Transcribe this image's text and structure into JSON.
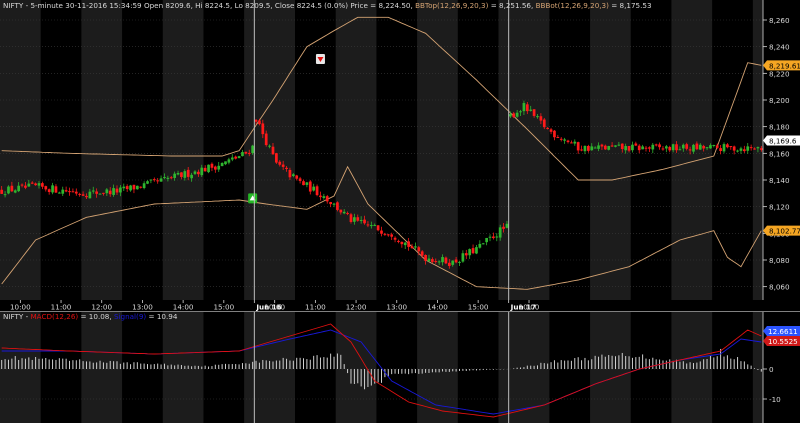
{
  "colors": {
    "background": "#000000",
    "band": "#1c1c1c",
    "grid": "#3a3a3a",
    "text": "#d8d8d8",
    "bullish": "#2fb52f",
    "bearish": "#ff1a1a",
    "bollinger": "#d4a373",
    "macd": "#e01010",
    "signal": "#1818d8",
    "histogram": "#d0d0d0",
    "bbtop_badge": "#f5a623",
    "price_badge": "#ffffff",
    "macd_badge": "#2b54ff",
    "signal_badge": "#d01818"
  },
  "chart_data": [
    {
      "type": "candlestick",
      "header": {
        "symbol": "NIFTY",
        "interval": "5-minute",
        "datetime": "30-11-2016 15:34:59",
        "open": "Open 8209.6,",
        "hi": "Hi 8224.5,",
        "lo": "Lo 8209.5,",
        "close": "Close 8224.5 (0.0%)",
        "price": "Price = 8,224.50,",
        "bbtop_label": "BBTop(12,26,9,20,3)",
        "bbtop_value": "= 8,251.56,",
        "bbbot_label": "BBBot(12,26,9,20,3)",
        "bbbot_value": "= 8,175.53"
      },
      "ylim": [
        8050,
        8275
      ],
      "yticks": [
        8060,
        8080,
        8100,
        8120,
        8140,
        8160,
        8180,
        8200,
        8220,
        8240,
        8260
      ],
      "ytick_labels": [
        "8,060",
        "8,080",
        "8,100",
        "8,120",
        "8,140",
        "8,160",
        "8,180",
        "8,200",
        "8,220",
        "8,240",
        "8,260"
      ],
      "xtick_labels": [
        "10:00",
        "11:00",
        "12:00",
        "13:00",
        "14:00",
        "15:00",
        "Jun 16",
        "10:00",
        "11:00",
        "12:00",
        "13:00",
        "14:00",
        "15:00",
        "Jun 17",
        "10:00"
      ],
      "n_bars": 225,
      "session_breaks_at_bar": [
        75,
        150
      ],
      "sessions": [
        {
          "start": 8132,
          "points": [
            [
              0,
              8132
            ],
            [
              10,
              8135
            ],
            [
              25,
              8130
            ],
            [
              35,
              8132
            ],
            [
              45,
              8138
            ],
            [
              55,
              8145
            ],
            [
              65,
              8152
            ],
            [
              72,
              8160
            ],
            [
              80,
              8180
            ],
            [
              88,
              8198
            ],
            [
              94,
              8212
            ],
            [
              100,
              8203
            ]
          ]
        },
        {
          "start": 8186,
          "points": [
            [
              0,
              8186
            ],
            [
              6,
              8152
            ],
            [
              12,
              8140
            ],
            [
              20,
              8128
            ],
            [
              28,
              8110
            ],
            [
              40,
              8100
            ],
            [
              50,
              8082
            ],
            [
              58,
              8078
            ],
            [
              66,
              8090
            ],
            [
              72,
              8102
            ],
            [
              80,
              8112
            ],
            [
              88,
              8122
            ],
            [
              96,
              8130
            ],
            [
              104,
              8138
            ],
            [
              110,
              8150
            ],
            [
              114,
              8154
            ],
            [
              118,
              8140
            ],
            [
              122,
              8138
            ]
          ]
        },
        {
          "start": 8188,
          "points": [
            [
              0,
              8188
            ],
            [
              4,
              8195
            ],
            [
              8,
              8185
            ],
            [
              12,
              8176
            ],
            [
              18,
              8168
            ],
            [
              20,
              8164
            ]
          ]
        }
      ],
      "bollinger_top": [
        [
          0,
          8162
        ],
        [
          20,
          8160
        ],
        [
          50,
          8158
        ],
        [
          65,
          8158
        ],
        [
          70,
          8162
        ],
        [
          80,
          8200
        ],
        [
          90,
          8240
        ],
        [
          98,
          8252
        ],
        [
          105,
          8262
        ],
        [
          114,
          8262
        ],
        [
          125,
          8250
        ],
        [
          140,
          8215
        ],
        [
          155,
          8178
        ],
        [
          170,
          8140
        ],
        [
          180,
          8140
        ],
        [
          195,
          8148
        ],
        [
          210,
          8158
        ],
        [
          220,
          8228
        ],
        [
          224,
          8226
        ]
      ],
      "bollinger_bottom": [
        [
          0,
          8062
        ],
        [
          10,
          8095
        ],
        [
          25,
          8112
        ],
        [
          45,
          8122
        ],
        [
          70,
          8125
        ],
        [
          78,
          8122
        ],
        [
          90,
          8118
        ],
        [
          98,
          8128
        ],
        [
          102,
          8150
        ],
        [
          108,
          8122
        ],
        [
          125,
          8080
        ],
        [
          140,
          8060
        ],
        [
          155,
          8058
        ],
        [
          170,
          8065
        ],
        [
          185,
          8075
        ],
        [
          200,
          8095
        ],
        [
          210,
          8102
        ],
        [
          214,
          8082
        ],
        [
          218,
          8075
        ],
        [
          224,
          8102
        ]
      ],
      "markers": [
        {
          "type": "sell",
          "bar": 94,
          "price": 8224
        },
        {
          "type": "buy",
          "bar": 74,
          "price": 8133
        }
      ],
      "badges": {
        "bbtop": "8,219.61",
        "price": "8,169.6",
        "bbbot": "8,102.77"
      }
    },
    {
      "type": "line+histogram",
      "header": {
        "symbol": "NIFTY",
        "macd_label": "MACD(12,26)",
        "macd_value": "= 10.08,",
        "signal_label": "Signal(9)",
        "signal_value": "= 10.94"
      },
      "ylim": [
        -18,
        19
      ],
      "yticks": [
        0,
        -10
      ],
      "ytick_labels": [
        "0",
        "-10"
      ],
      "macd": [
        [
          0,
          7
        ],
        [
          20,
          6
        ],
        [
          45,
          5
        ],
        [
          70,
          6
        ],
        [
          85,
          11
        ],
        [
          97,
          15
        ],
        [
          103,
          9
        ],
        [
          110,
          -4
        ],
        [
          120,
          -11
        ],
        [
          130,
          -14
        ],
        [
          145,
          -16
        ],
        [
          160,
          -12
        ],
        [
          175,
          -5
        ],
        [
          188,
          0
        ],
        [
          200,
          3
        ],
        [
          212,
          6
        ],
        [
          220,
          13
        ],
        [
          224,
          11
        ]
      ],
      "signal": [
        [
          0,
          6
        ],
        [
          20,
          6
        ],
        [
          45,
          5
        ],
        [
          70,
          6
        ],
        [
          85,
          10
        ],
        [
          97,
          13
        ],
        [
          106,
          9
        ],
        [
          115,
          -4
        ],
        [
          128,
          -12
        ],
        [
          145,
          -15
        ],
        [
          160,
          -12
        ],
        [
          175,
          -5
        ],
        [
          188,
          0
        ],
        [
          200,
          3
        ],
        [
          212,
          5
        ],
        [
          218,
          10
        ],
        [
          224,
          9
        ]
      ],
      "histogram_envelope": [
        [
          0,
          4
        ],
        [
          60,
          1
        ],
        [
          90,
          4
        ],
        [
          100,
          5
        ],
        [
          103,
          -5
        ],
        [
          108,
          -7
        ],
        [
          115,
          -2
        ],
        [
          130,
          -1
        ],
        [
          150,
          0
        ],
        [
          165,
          3
        ],
        [
          185,
          5
        ],
        [
          205,
          2
        ],
        [
          212,
          6
        ],
        [
          218,
          3
        ],
        [
          224,
          -1
        ]
      ],
      "badges": {
        "macd": "12.6611",
        "signal": "10.5525"
      }
    }
  ]
}
